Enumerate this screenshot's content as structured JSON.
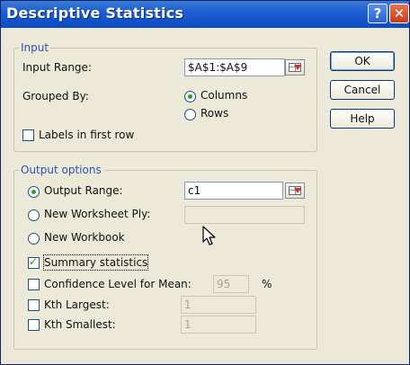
{
  "window": {
    "title": "Descriptive Statistics",
    "help_glyph": "?",
    "close_glyph": "✕"
  },
  "input_group": {
    "legend": "Input",
    "input_range_label": "Input Range:",
    "input_range_value": "$A$1:$A$9",
    "grouped_by_label": "Grouped By:",
    "grouped_options": [
      "Columns",
      "Rows"
    ],
    "grouped_selected": "Columns",
    "labels_first_row_label": "Labels in first row",
    "labels_first_row_checked": false
  },
  "output_group": {
    "legend": "Output options",
    "output_range_label": "Output Range:",
    "output_range_value": "c1",
    "new_ply_label": "New Worksheet Ply:",
    "new_ply_value": "",
    "new_workbook_label": "New Workbook",
    "selected_destination": "Output Range",
    "summary_stats_label": "Summary statistics",
    "summary_stats_checked": true,
    "confidence_label": "Confidence Level for Mean:",
    "confidence_value": "95",
    "confidence_unit": "%",
    "confidence_checked": false,
    "kth_largest_label": "Kth Largest:",
    "kth_largest_value": "1",
    "kth_largest_checked": false,
    "kth_smallest_label": "Kth Smallest:",
    "kth_smallest_value": "1",
    "kth_smallest_checked": false
  },
  "buttons": {
    "ok": "OK",
    "cancel": "Cancel",
    "help": "Help"
  },
  "icons": {
    "range_select": "range-select-icon",
    "cursor": "mouse-pointer-icon"
  }
}
